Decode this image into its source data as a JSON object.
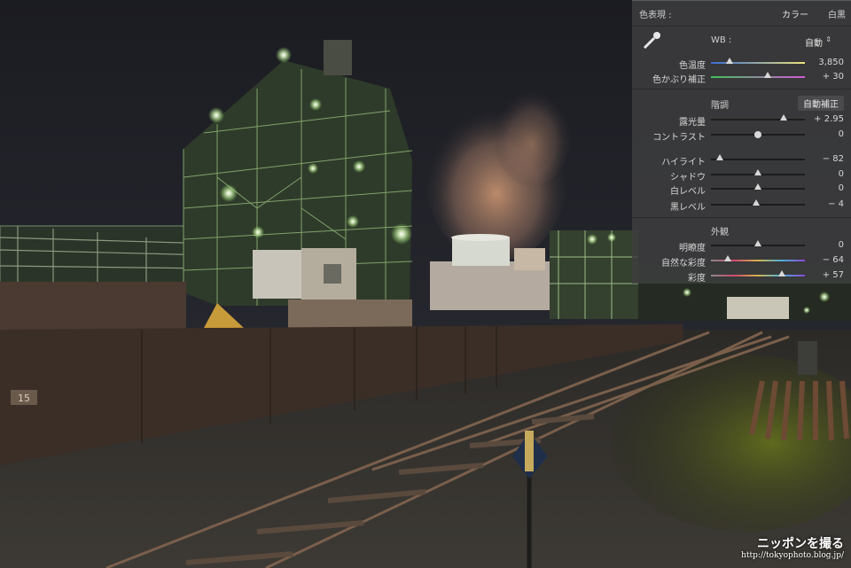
{
  "panel": {
    "treatment": {
      "label": "色表現 :",
      "color": "カラー",
      "bw": "白黒"
    },
    "wb": {
      "label": "WB :",
      "value": "自動",
      "temp": {
        "label": "色温度",
        "value": "3,850",
        "pos": 0.2
      },
      "tint": {
        "label": "色かぶり補正",
        "value": "+ 30",
        "pos": 0.6
      }
    },
    "tone": {
      "title": "階調",
      "auto": "自動補正",
      "sliders": [
        {
          "label": "露光量",
          "value": "+ 2.95",
          "pos": 0.77,
          "kind": "tri"
        },
        {
          "label": "コントラスト",
          "value": "0",
          "pos": 0.5,
          "kind": "round"
        },
        {
          "label": "ハイライト",
          "value": "− 82",
          "pos": 0.09,
          "kind": "tri"
        },
        {
          "label": "シャドウ",
          "value": "0",
          "pos": 0.5,
          "kind": "tri"
        },
        {
          "label": "白レベル",
          "value": "0",
          "pos": 0.5,
          "kind": "tri"
        },
        {
          "label": "黒レベル",
          "value": "− 4",
          "pos": 0.48,
          "kind": "tri"
        }
      ]
    },
    "presence": {
      "title": "外観",
      "sliders": [
        {
          "label": "明瞭度",
          "value": "0",
          "pos": 0.5,
          "kind": "tri"
        },
        {
          "label": "自然な彩度",
          "value": "− 64",
          "pos": 0.18,
          "kind": "tri"
        },
        {
          "label": "彩度",
          "value": "+ 57",
          "pos": 0.75,
          "kind": "tri"
        }
      ]
    }
  },
  "watermark": {
    "title": "ニッポンを撮る",
    "url": "http://tokyophoto.blog.jp/"
  },
  "sign": {
    "number": "15"
  },
  "colors": {
    "sky": "#1e2027",
    "lights": "#c8ff9a",
    "wall": "#3a2e27",
    "steam": "#b98868"
  }
}
